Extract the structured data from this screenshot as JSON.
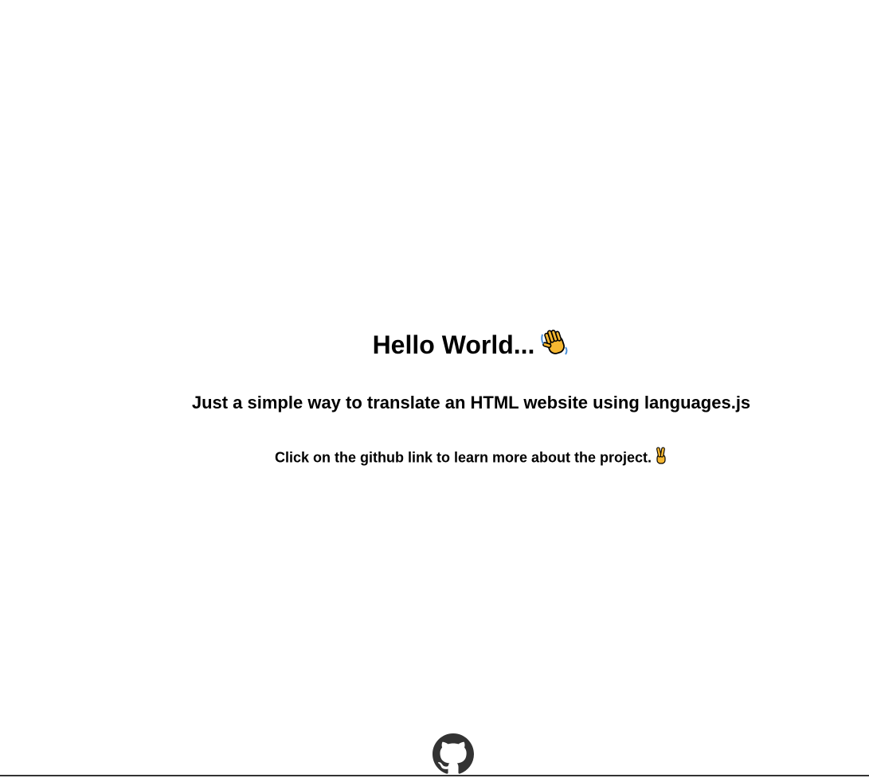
{
  "main": {
    "title": "Hello World...",
    "title_icon": "waving-hand-icon",
    "subtitle": "Just a simple way to translate an HTML website using languages.js",
    "hint": "Click on the github link to learn more about the project.",
    "hint_icon": "victory-hand-icon"
  },
  "footer": {
    "link_icon": "github-icon"
  },
  "colors": {
    "text": "#000000",
    "background": "#ffffff",
    "github": "#333333",
    "emoji_yellow": "#f5b731"
  }
}
